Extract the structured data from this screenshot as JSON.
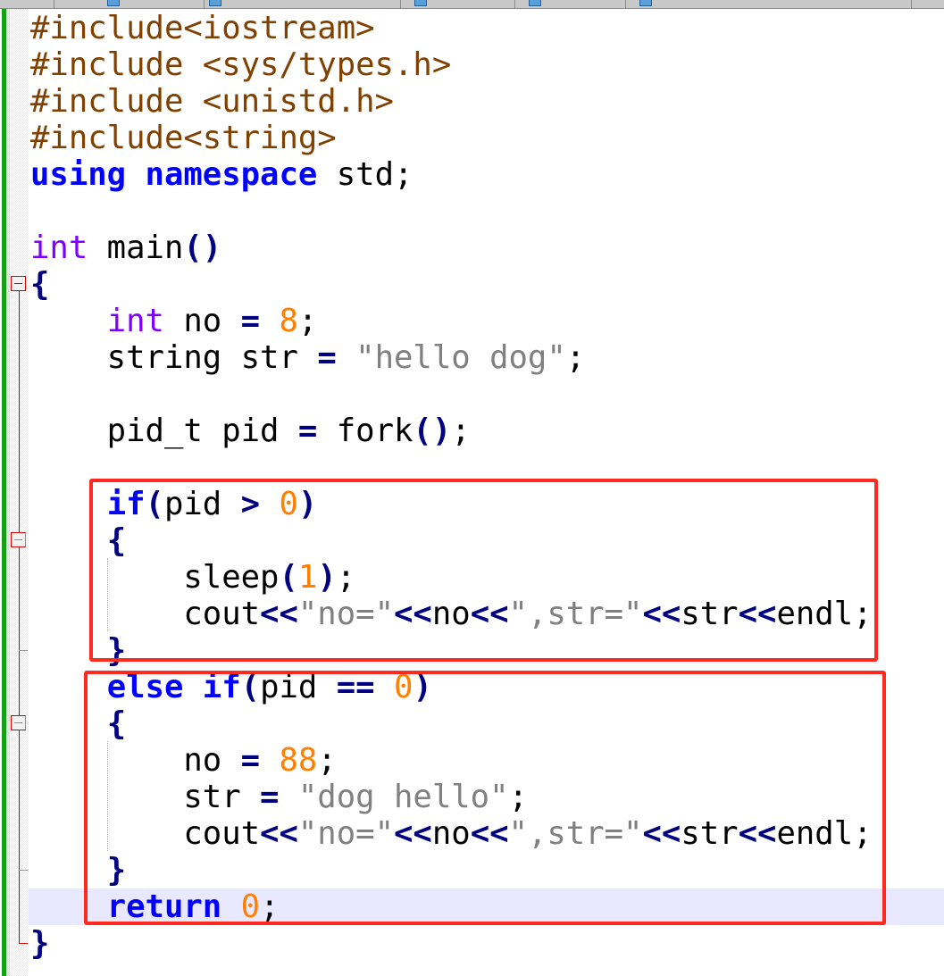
{
  "editor": {
    "tab_count": 6,
    "lines": [
      [
        {
          "t": "#include<iostream>",
          "c": "pp"
        }
      ],
      [
        {
          "t": "#include <sys/types.h>",
          "c": "pp"
        }
      ],
      [
        {
          "t": "#include <unistd.h>",
          "c": "pp"
        }
      ],
      [
        {
          "t": "#include<string>",
          "c": "pp"
        }
      ],
      [
        {
          "t": "using",
          "c": "kw"
        },
        {
          "t": " "
        },
        {
          "t": "namespace",
          "c": "kw"
        },
        {
          "t": " std;"
        }
      ],
      [],
      [
        {
          "t": "int",
          "c": "ty"
        },
        {
          "t": " main"
        },
        {
          "t": "()",
          "c": "op"
        }
      ],
      [
        {
          "t": "{",
          "c": "op"
        }
      ],
      [
        {
          "t": "    "
        },
        {
          "t": "int",
          "c": "ty"
        },
        {
          "t": " no "
        },
        {
          "t": "=",
          "c": "op"
        },
        {
          "t": " "
        },
        {
          "t": "8",
          "c": "num"
        },
        {
          "t": ";"
        }
      ],
      [
        {
          "t": "    string str "
        },
        {
          "t": "=",
          "c": "op"
        },
        {
          "t": " "
        },
        {
          "t": "\"hello dog\"",
          "c": "str"
        },
        {
          "t": ";"
        }
      ],
      [],
      [
        {
          "t": "    pid_t pid "
        },
        {
          "t": "=",
          "c": "op"
        },
        {
          "t": " fork"
        },
        {
          "t": "()",
          "c": "op"
        },
        {
          "t": ";"
        }
      ],
      [],
      [
        {
          "t": "    "
        },
        {
          "t": "if",
          "c": "kw"
        },
        {
          "t": "(",
          "c": "op"
        },
        {
          "t": "pid "
        },
        {
          "t": ">",
          "c": "op"
        },
        {
          "t": " "
        },
        {
          "t": "0",
          "c": "num"
        },
        {
          "t": ")",
          "c": "op"
        }
      ],
      [
        {
          "t": "    "
        },
        {
          "t": "{",
          "c": "op"
        }
      ],
      [
        {
          "t": "        sleep"
        },
        {
          "t": "(",
          "c": "op"
        },
        {
          "t": "1",
          "c": "num"
        },
        {
          "t": ")",
          "c": "op"
        },
        {
          "t": ";"
        }
      ],
      [
        {
          "t": "        cout"
        },
        {
          "t": "<<",
          "c": "op"
        },
        {
          "t": "\"no=\"",
          "c": "str"
        },
        {
          "t": "<<",
          "c": "op"
        },
        {
          "t": "no"
        },
        {
          "t": "<<",
          "c": "op"
        },
        {
          "t": "\",str=\"",
          "c": "str"
        },
        {
          "t": "<<",
          "c": "op"
        },
        {
          "t": "str"
        },
        {
          "t": "<<",
          "c": "op"
        },
        {
          "t": "endl;"
        }
      ],
      [
        {
          "t": "    "
        },
        {
          "t": "}",
          "c": "op"
        }
      ],
      [
        {
          "t": "    "
        },
        {
          "t": "else",
          "c": "kw"
        },
        {
          "t": " "
        },
        {
          "t": "if",
          "c": "kw"
        },
        {
          "t": "(",
          "c": "op"
        },
        {
          "t": "pid "
        },
        {
          "t": "==",
          "c": "op"
        },
        {
          "t": " "
        },
        {
          "t": "0",
          "c": "num"
        },
        {
          "t": ")",
          "c": "op"
        }
      ],
      [
        {
          "t": "    "
        },
        {
          "t": "{",
          "c": "op"
        }
      ],
      [
        {
          "t": "        no "
        },
        {
          "t": "=",
          "c": "op"
        },
        {
          "t": " "
        },
        {
          "t": "88",
          "c": "num"
        },
        {
          "t": ";"
        }
      ],
      [
        {
          "t": "        str "
        },
        {
          "t": "=",
          "c": "op"
        },
        {
          "t": " "
        },
        {
          "t": "\"dog hello\"",
          "c": "str"
        },
        {
          "t": ";"
        }
      ],
      [
        {
          "t": "        cout"
        },
        {
          "t": "<<",
          "c": "op"
        },
        {
          "t": "\"no=\"",
          "c": "str"
        },
        {
          "t": "<<",
          "c": "op"
        },
        {
          "t": "no"
        },
        {
          "t": "<<",
          "c": "op"
        },
        {
          "t": "\",str=\"",
          "c": "str"
        },
        {
          "t": "<<",
          "c": "op"
        },
        {
          "t": "str"
        },
        {
          "t": "<<",
          "c": "op"
        },
        {
          "t": "endl;"
        }
      ],
      [
        {
          "t": "    "
        },
        {
          "t": "}",
          "c": "op"
        }
      ],
      [
        {
          "t": "    "
        },
        {
          "t": "return",
          "c": "kw"
        },
        {
          "t": " "
        },
        {
          "t": "0",
          "c": "num"
        },
        {
          "t": ";"
        }
      ],
      [
        {
          "t": "}",
          "c": "op"
        }
      ]
    ],
    "current_line": 25,
    "highlight_color": "#ff2a1f",
    "annotations": [
      {
        "label": "parent-branch-highlight",
        "from_line": 14,
        "to_line": 18
      },
      {
        "label": "child-branch-highlight",
        "from_line": 19,
        "to_line": 25
      }
    ]
  }
}
